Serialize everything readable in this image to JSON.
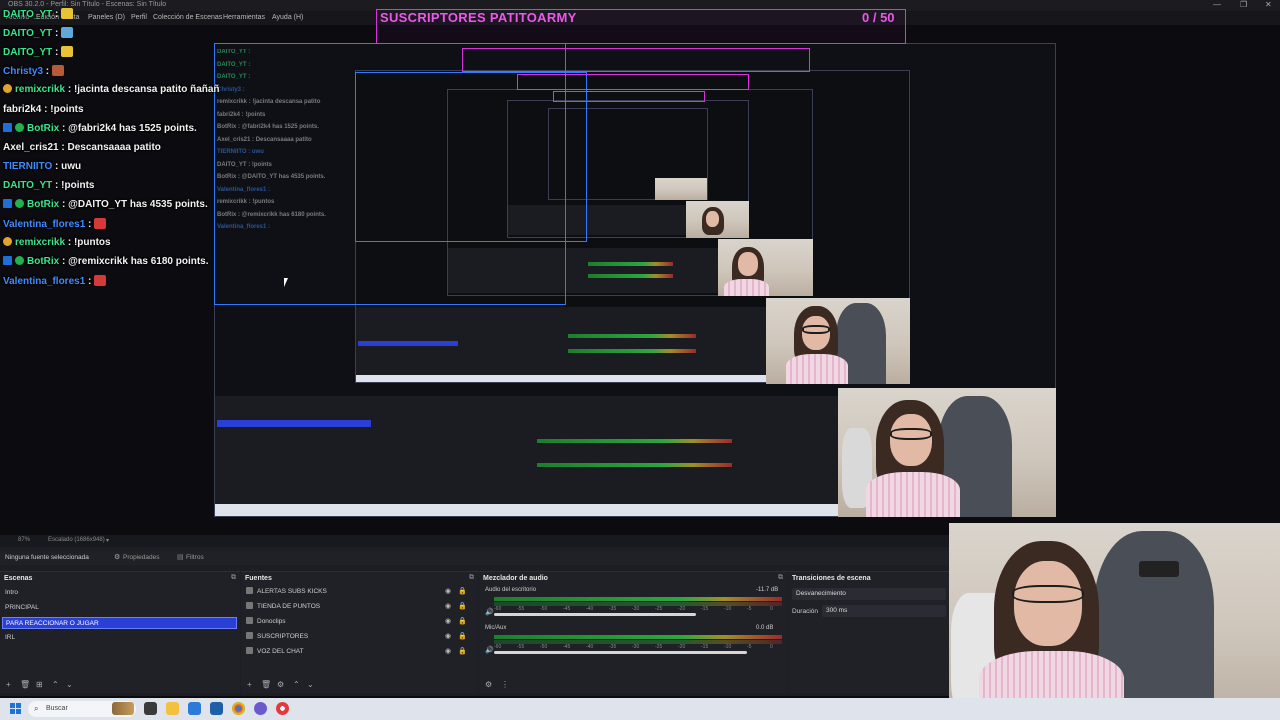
{
  "window": {
    "title": "OBS 30.2.0 - Perfil: Sin Título - Escenas: Sin Título",
    "controls": [
      "—",
      "❐",
      "✕"
    ]
  },
  "menu": {
    "items": [
      "Archivo",
      "Edición",
      "Vista",
      "Paneles (D)",
      "Perfil",
      "Colección de Escenas",
      "Herramientas",
      "Ayuda (H)"
    ]
  },
  "subs_goal": {
    "title": "SUSCRIPTORES PATITOARMY",
    "count": "0  / 50",
    "accent": "#e85ae8"
  },
  "chat": [
    {
      "name": "DAITO_YT",
      "sep": " : ",
      "msg": "",
      "name_color": "#39e68e",
      "badge": "",
      "emote": "gold-duck"
    },
    {
      "name": "DAITO_YT",
      "sep": " : ",
      "msg": "",
      "name_color": "#39e68e",
      "badge": "",
      "emote": "blue-duck"
    },
    {
      "name": "DAITO_YT",
      "sep": " : ",
      "msg": "",
      "name_color": "#39e68e",
      "badge": "",
      "emote": "gold-duck"
    },
    {
      "name": "Christy3",
      "sep": " : ",
      "msg": "",
      "name_color": "#3f8cff",
      "badge": "",
      "emote": "portrait"
    },
    {
      "name": "remixcrikk",
      "sep": " : ",
      "msg": "!jacinta descansa patito ñañañ",
      "name_color": "#39e68e",
      "badge": "warn",
      "emote": ""
    },
    {
      "name": "fabri2k4",
      "sep": " : ",
      "msg": "!points",
      "name_color": "#f2f2f2",
      "badge": "",
      "emote": ""
    },
    {
      "name": "BotRix",
      "sep": " : ",
      "msg": "@fabri2k4 has 1525 points.",
      "name_color": "#39e68e",
      "badge": "bot",
      "emote": ""
    },
    {
      "name": "Axel_cris21",
      "sep": " : ",
      "msg": "Descansaaaa patito",
      "name_color": "#f2f2f2",
      "badge": "",
      "emote": ""
    },
    {
      "name": "TIERNIITO",
      "sep": " : ",
      "msg": "uwu",
      "name_color": "#3f8cff",
      "badge": "",
      "emote": ""
    },
    {
      "name": "DAITO_YT",
      "sep": " : ",
      "msg": "!points",
      "name_color": "#39e68e",
      "badge": "",
      "emote": ""
    },
    {
      "name": "BotRix",
      "sep": " : ",
      "msg": "@DAITO_YT has 4535 points.",
      "name_color": "#39e68e",
      "badge": "bot",
      "emote": ""
    },
    {
      "name": "Valentina_flores1",
      "sep": " : ",
      "msg": "",
      "name_color": "#3f8cff",
      "badge": "",
      "emote": "red-heart"
    },
    {
      "name": "remixcrikk",
      "sep": " : ",
      "msg": "!puntos",
      "name_color": "#39e68e",
      "badge": "warn",
      "emote": ""
    },
    {
      "name": "BotRix",
      "sep": " : ",
      "msg": "@remixcrikk has 6180 points.",
      "name_color": "#39e68e",
      "badge": "bot",
      "emote": ""
    },
    {
      "name": "Valentina_flores1",
      "sep": " : ",
      "msg": "",
      "name_color": "#3f8cff",
      "badge": "",
      "emote": "red-heart"
    }
  ],
  "statusline": {
    "zoom": "87%",
    "scale": "Escalado (1686x948)"
  },
  "source_bar": {
    "no_source": "Ninguna fuente seleccionada",
    "properties": "Propiedades",
    "filters": "Filtros"
  },
  "scenes": {
    "title": "Escenas",
    "items": [
      {
        "label": "Intro",
        "active": false
      },
      {
        "label": "PRINCIPAL",
        "active": false
      },
      {
        "label": "PARA REACCIONAR O JUGAR",
        "active": true
      },
      {
        "label": "IRL",
        "active": false
      }
    ]
  },
  "sources": {
    "title": "Fuentes",
    "items": [
      {
        "label": "ALERTAS SUBS KICKS"
      },
      {
        "label": "TIENDA DE PUNTOS"
      },
      {
        "label": "Donoclips"
      },
      {
        "label": "SUSCRIPTORES"
      },
      {
        "label": "VOZ DEL CHAT"
      }
    ]
  },
  "mixer": {
    "title": "Mezclador de audio",
    "tracks": [
      {
        "name": "Audio del escritorio",
        "db": "-11.7 dB",
        "level": 0.7
      },
      {
        "name": "Mic/Aux",
        "db": "0.0 dB",
        "level": 0.88
      }
    ],
    "scale": [
      "-60",
      "-55",
      "-50",
      "-45",
      "-40",
      "-35",
      "-30",
      "-25",
      "-20",
      "-15",
      "-10",
      "-5",
      "0"
    ]
  },
  "transitions": {
    "title": "Transiciones de escena",
    "selected": "Desvanecimiento",
    "duration_label": "Duración",
    "duration_value": "300 ms"
  },
  "taskbar": {
    "search_placeholder": "Buscar",
    "apps": [
      "landscape-thumb",
      "file-icon",
      "folder-icon",
      "store-icon",
      "app-icon",
      "chrome-icon",
      "edge-icon",
      "obs-icon",
      "red-app-icon"
    ]
  }
}
